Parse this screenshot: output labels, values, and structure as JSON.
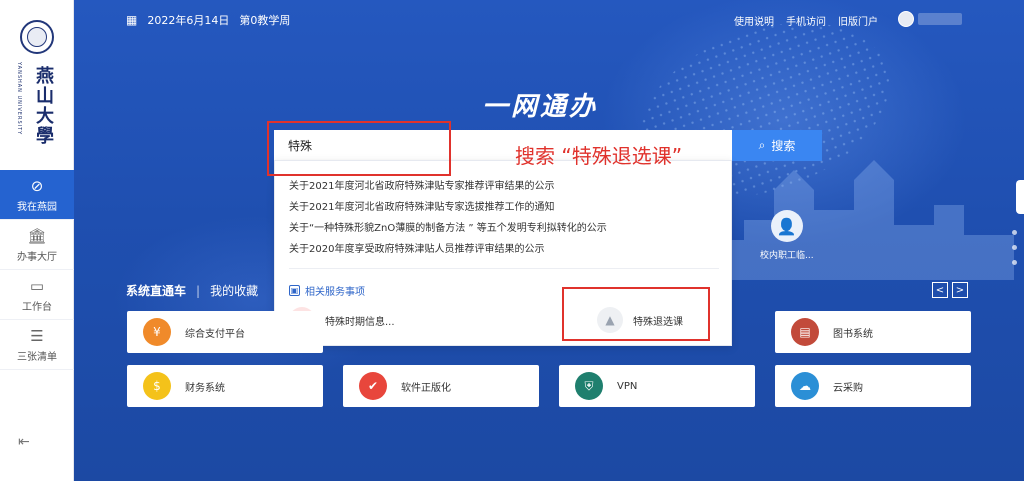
{
  "sidebar": {
    "logo_cn": "燕山大學",
    "logo_en": "YANSHAN UNIVERSITY",
    "items": [
      {
        "label": "我在燕园",
        "icon": "compass-icon",
        "active": true
      },
      {
        "label": "办事大厅",
        "icon": "hall-icon",
        "active": false
      },
      {
        "label": "工作台",
        "icon": "workbench-icon",
        "active": false
      },
      {
        "label": "三张清单",
        "icon": "list-icon",
        "active": false
      }
    ]
  },
  "header": {
    "date": "2022年6月14日",
    "week": "第0教学周",
    "links": [
      "使用说明",
      "手机访问",
      "旧版门户"
    ]
  },
  "hero_title": "一网通办",
  "search": {
    "value": "特殊",
    "button_label": "搜索"
  },
  "suggestions": [
    "关于2021年度河北省政府特殊津贴专家推荐评审结果的公示",
    "关于2021年度河北省政府特殊津贴专家选拔推荐工作的通知",
    "关于“一种特殊形貌ZnO薄膜的制备方法 ” 等五个发明专利拟转化的公示",
    "关于2020年度享受政府特殊津贴人员推荐评审结果的公示"
  ],
  "related": {
    "title": "相关服务事项",
    "items": [
      "特殊时期信息...",
      "特殊退选课"
    ]
  },
  "annotation": "搜索 “特殊退选课”",
  "teacher_app": "校内职工临...",
  "section": {
    "tab_active": "系统直通车",
    "tab_other": "我的收藏"
  },
  "cards": [
    {
      "label": "综合支付平台",
      "icon": "payment-icon",
      "color": "#f08a2a"
    },
    {
      "label": "图书系统",
      "icon": "library-icon",
      "color": "#c24a3a"
    },
    {
      "label": "财务系统",
      "icon": "finance-icon",
      "color": "#f4c21a"
    },
    {
      "label": "软件正版化",
      "icon": "software-icon",
      "color": "#e8463c"
    },
    {
      "label": "VPN",
      "icon": "vpn-icon",
      "color": "#1f7f6e"
    },
    {
      "label": "云采购",
      "icon": "procurement-icon",
      "color": "#2b8fd6"
    }
  ],
  "colors": {
    "primary": "#2563d0",
    "accent": "#3a86f2",
    "annotation": "#e0322c"
  }
}
